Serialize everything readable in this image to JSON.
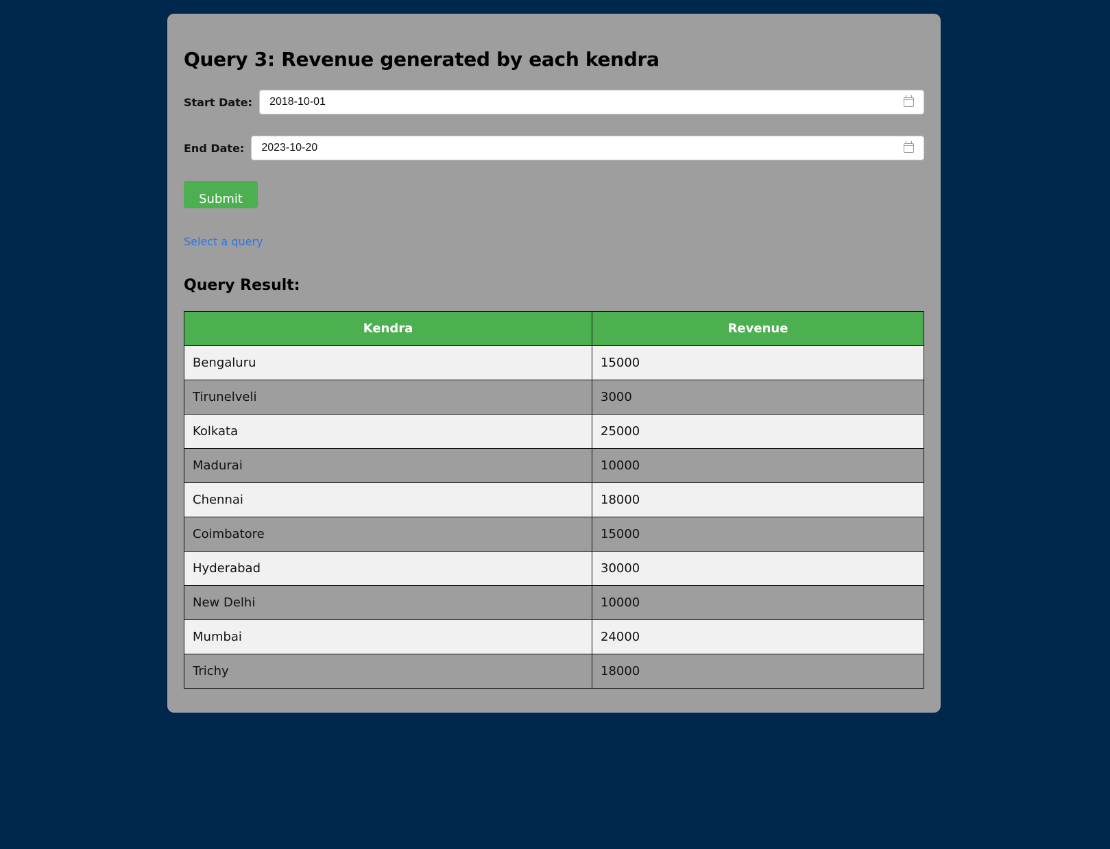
{
  "page": {
    "title": "Query 3: Revenue generated by each kendra",
    "start_date_label": "Start Date:",
    "start_date_value": "2018-10-01",
    "end_date_label": "End Date:",
    "end_date_value": "2023-10-20",
    "submit_label": "Submit",
    "select_query_link": "Select a query",
    "result_title": "Query Result:"
  },
  "table": {
    "headers": [
      "Kendra",
      "Revenue"
    ],
    "rows": [
      [
        "Bengaluru",
        "15000"
      ],
      [
        "Tirunelveli",
        "3000"
      ],
      [
        "Kolkata",
        "25000"
      ],
      [
        "Madurai",
        "10000"
      ],
      [
        "Chennai",
        "18000"
      ],
      [
        "Coimbatore",
        "15000"
      ],
      [
        "Hyderabad",
        "30000"
      ],
      [
        "New Delhi",
        "10000"
      ],
      [
        "Mumbai",
        "24000"
      ],
      [
        "Trichy",
        "18000"
      ]
    ]
  },
  "colors": {
    "background": "#00284d",
    "card": "#9e9e9e",
    "accent_green": "#4caf50",
    "link_blue": "#2f74e0",
    "row_light": "#f1f1f1"
  },
  "icons": {
    "date_picker": "calendar-icon"
  }
}
